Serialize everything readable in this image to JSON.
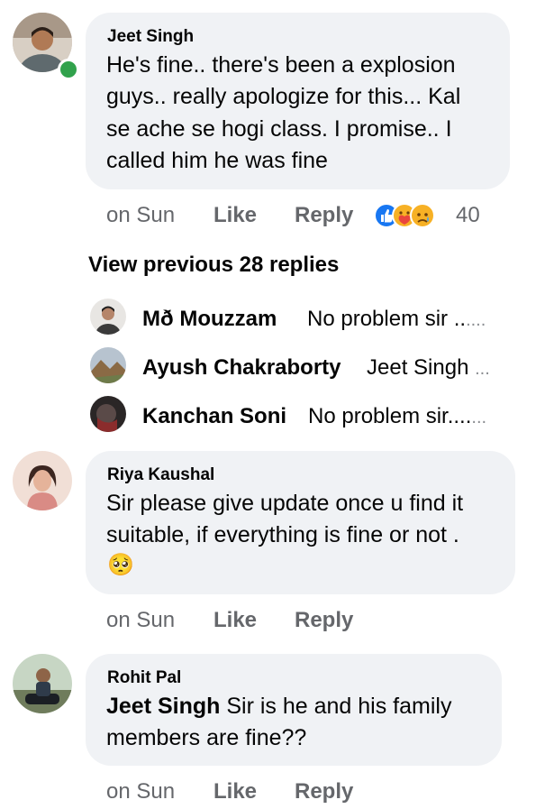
{
  "comments": [
    {
      "author": "Jeet Singh",
      "lines": [
        "He's fine.. there's been a explosion",
        "guys.. really apologize for this... Kal",
        "se ache se hogi class. I promise.. I",
        "called him he was fine"
      ],
      "time": "on Sun",
      "like": "Like",
      "reply": "Reply",
      "reaction_count": "40"
    },
    {
      "author": "Riya Kaushal",
      "lines": [
        "Sir please give update once u find it",
        "suitable,  if everything is fine or not ."
      ],
      "emoji": "🥺",
      "time": "on Sun",
      "like": "Like",
      "reply": "Reply"
    },
    {
      "author": "Rohit Pal",
      "mention": "Jeet Singh",
      "line1_rest": " Sir is he and his family",
      "line2": "members are fine??",
      "time": "on Sun",
      "like": "Like",
      "reply": "Reply"
    }
  ],
  "view_previous": "View previous 28 replies",
  "replies": [
    {
      "name": "Mð Mouzzam",
      "text": "No problem sir ..",
      "ellipsis": "...."
    },
    {
      "name": "Ayush Chakraborty",
      "text": "Jeet Singh",
      "ellipsis": "..."
    },
    {
      "name": "Kanchan Soni",
      "text": "No problem sir....",
      "ellipsis": "..."
    }
  ],
  "colors": {
    "bubble": "#f0f2f5",
    "meta": "#65676b",
    "online": "#31a24c",
    "like_reaction": "#1877f2"
  }
}
